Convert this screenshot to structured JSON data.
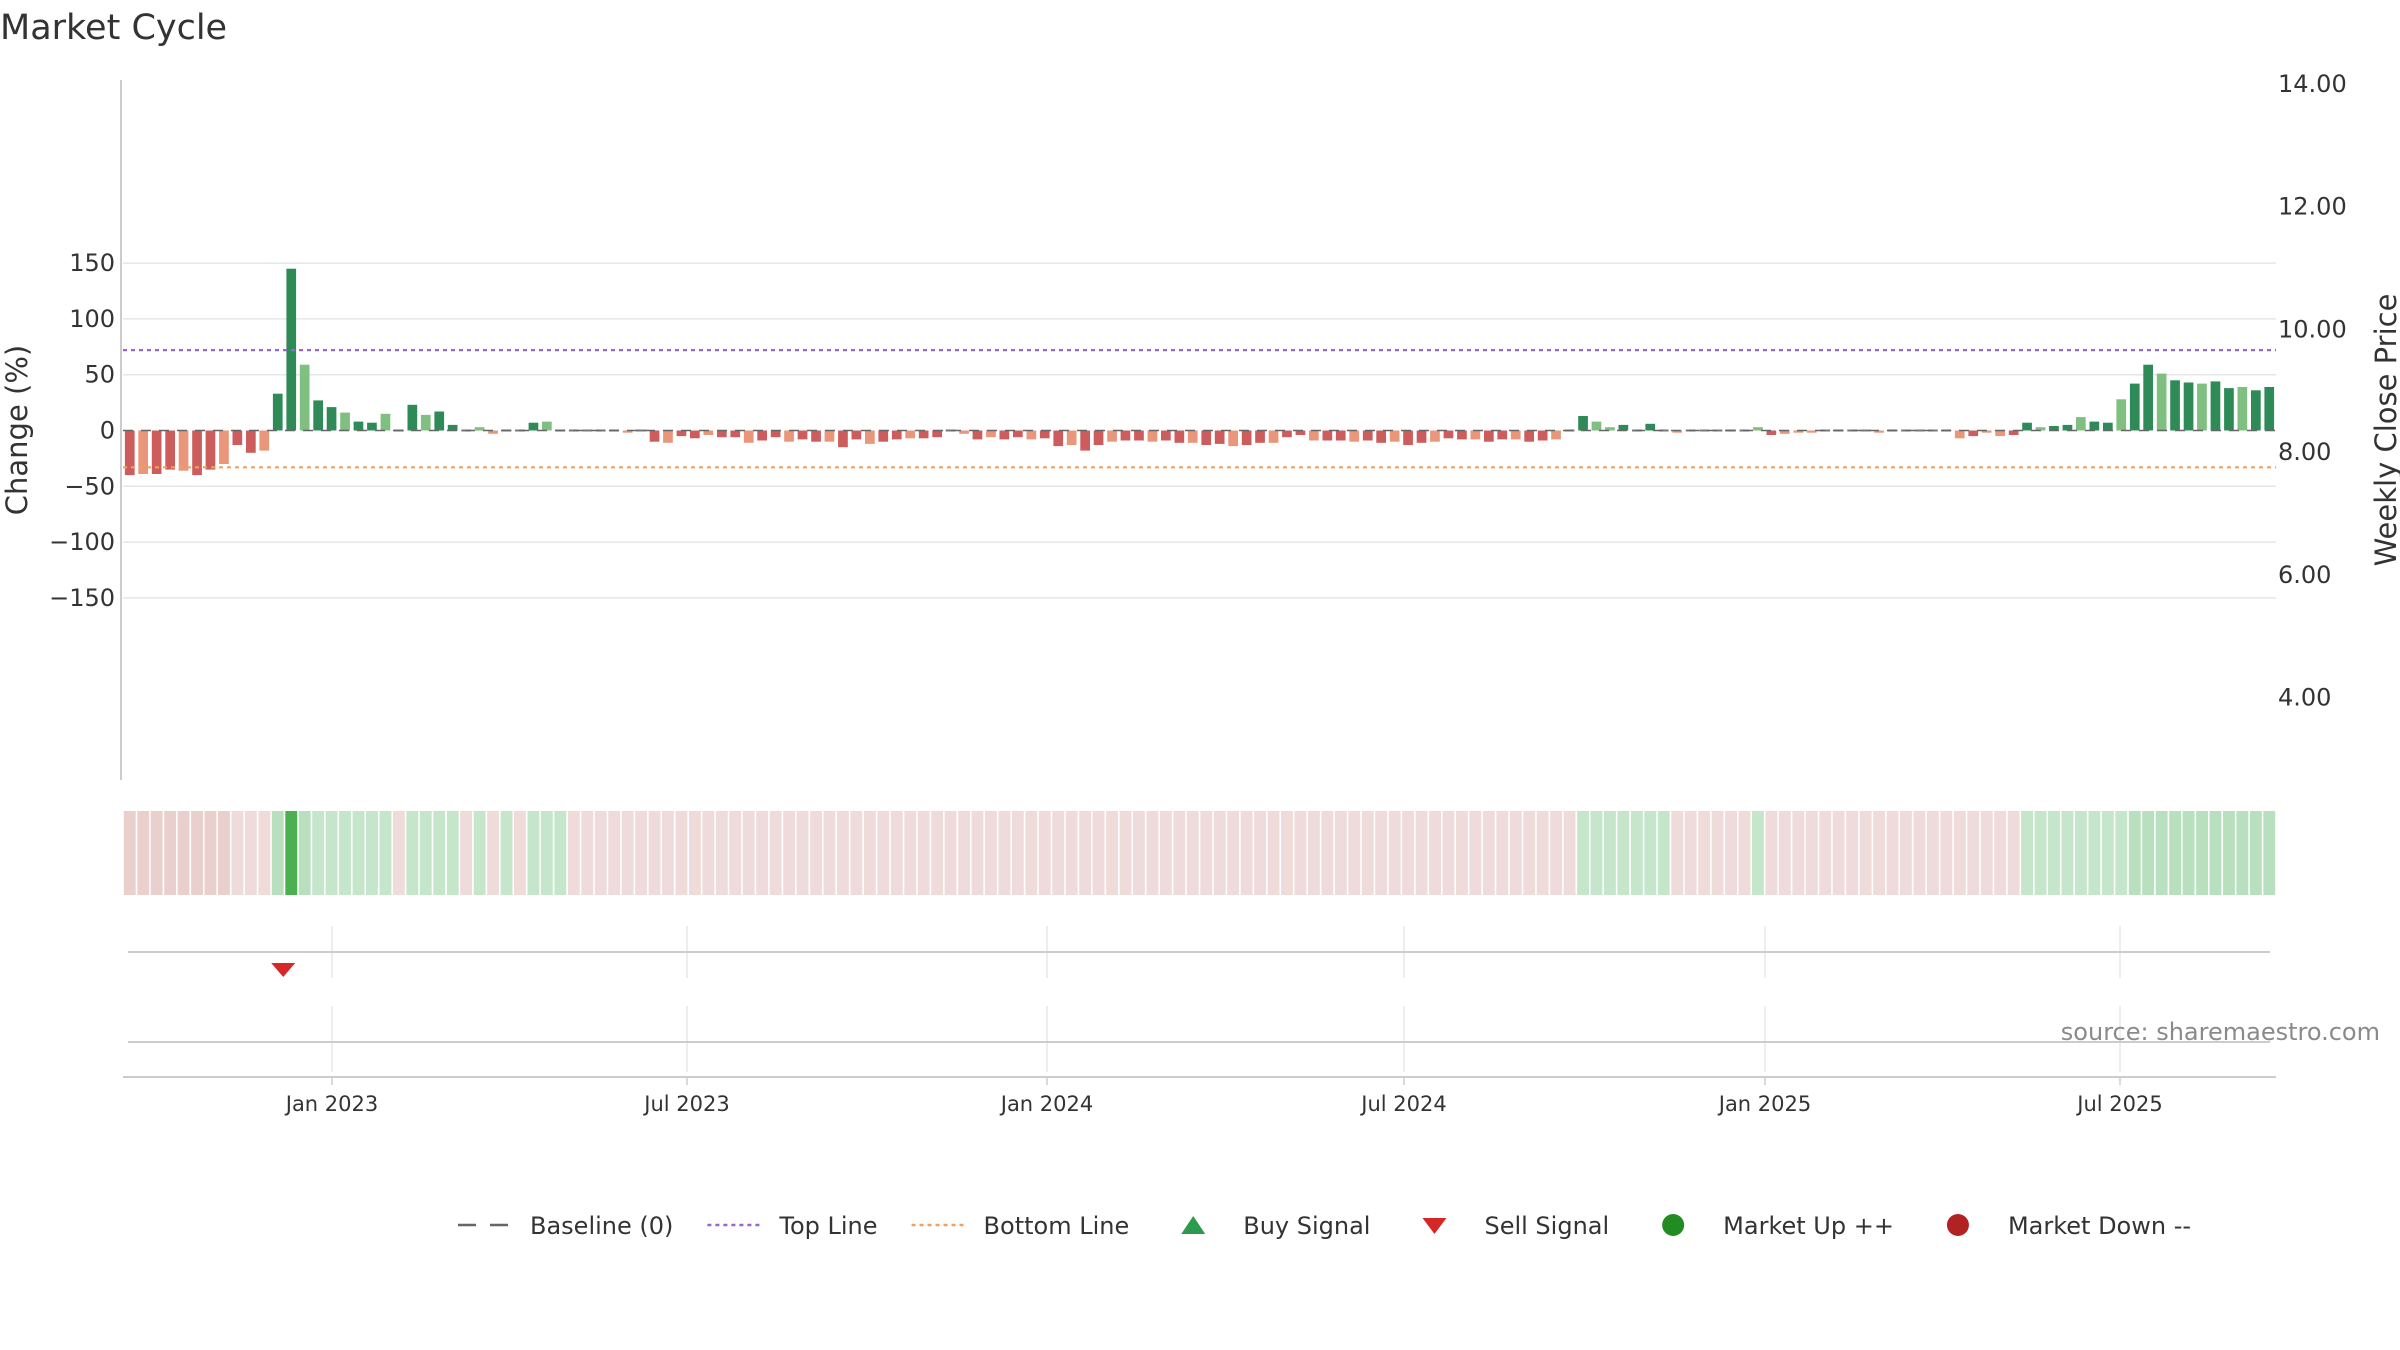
{
  "chart_data": {
    "type": "bar",
    "title": "Market Cycle",
    "ylabel": "Change (%)",
    "y2label": "Weekly Close Price",
    "ylim": [
      -155,
      157
    ],
    "y_ticks": [
      150,
      100,
      50,
      0,
      -50,
      -100,
      -150
    ],
    "y_tick_labels": [
      "150",
      "100",
      "50",
      "0",
      "−50",
      "−100",
      "−150"
    ],
    "y2_ticks": [
      "14.00",
      "12.00",
      "10.00",
      "8.00",
      "6.00",
      "4.00"
    ],
    "x_tick_labels": [
      "Jan 2023",
      "Jul 2023",
      "Jan 2024",
      "Jul 2024",
      "Jan 2025",
      "Jul 2025"
    ],
    "top_line": 72,
    "bottom_line": -33,
    "grid": true,
    "legend_position": "bottom-center",
    "values": [
      -40,
      -39,
      -39,
      -35,
      -36,
      -40,
      -35,
      -30,
      -13,
      -20,
      -18,
      33,
      145,
      59,
      27,
      21,
      16,
      8,
      7,
      15,
      0,
      23,
      14,
      17,
      5,
      0,
      3,
      -3,
      1,
      0,
      7,
      8,
      1,
      -1,
      0,
      0,
      0,
      -2,
      -1,
      -10,
      -11,
      -5,
      -7,
      -4,
      -6,
      -6,
      -11,
      -9,
      -6,
      -10,
      -8,
      -10,
      -10,
      -15,
      -8,
      -12,
      -10,
      -8,
      -7,
      -7,
      -6,
      -1,
      -3,
      -8,
      -6,
      -8,
      -6,
      -8,
      -7,
      -14,
      -13,
      -18,
      -13,
      -10,
      -9,
      -9,
      -10,
      -9,
      -11,
      -11,
      -13,
      -12,
      -14,
      -13,
      -11,
      -11,
      -6,
      -4,
      -9,
      -9,
      -9,
      -10,
      -9,
      -11,
      -10,
      -13,
      -11,
      -10,
      -7,
      -8,
      -8,
      -10,
      -8,
      -8,
      -10,
      -9,
      -8,
      -1,
      13,
      8,
      3,
      5,
      1,
      6,
      1,
      -2,
      0,
      0,
      0,
      0,
      0,
      3,
      -4,
      -3,
      -2,
      -2,
      0,
      0,
      0,
      0,
      -2,
      0,
      0,
      0,
      0,
      0,
      -7,
      -5,
      -2,
      -5,
      -4,
      7,
      3,
      4,
      5,
      12,
      8,
      7,
      28,
      42,
      59,
      51,
      45,
      43,
      42,
      44,
      38,
      39,
      36,
      39
    ],
    "bar_intensity_key": "dark = strong, light = weak",
    "sell_signal_index": 12,
    "source": "source: sharemaestro.com",
    "legend": [
      {
        "label": "Baseline (0)",
        "symbol": "dash",
        "color": "#666666"
      },
      {
        "label": "Top Line",
        "symbol": "dotted",
        "color": "#9966cc"
      },
      {
        "label": "Bottom Line",
        "symbol": "dotted",
        "color": "#f0a060"
      },
      {
        "label": "Buy Signal",
        "symbol": "triangle-up",
        "color": "#2e9a4e"
      },
      {
        "label": "Sell Signal",
        "symbol": "triangle-down",
        "color": "#d62728"
      },
      {
        "label": "Market Up ++",
        "symbol": "circle",
        "color": "#228b22"
      },
      {
        "label": "Market Down --",
        "symbol": "circle",
        "color": "#b22222"
      }
    ],
    "colors": {
      "strong_up": "#2e8b57",
      "weak_up": "#7fbf7f",
      "strong_down": "#cd5c5c",
      "weak_down": "#e9967a",
      "strip_up": "#b8e0bf",
      "strip_down": "#ead0cd"
    }
  }
}
